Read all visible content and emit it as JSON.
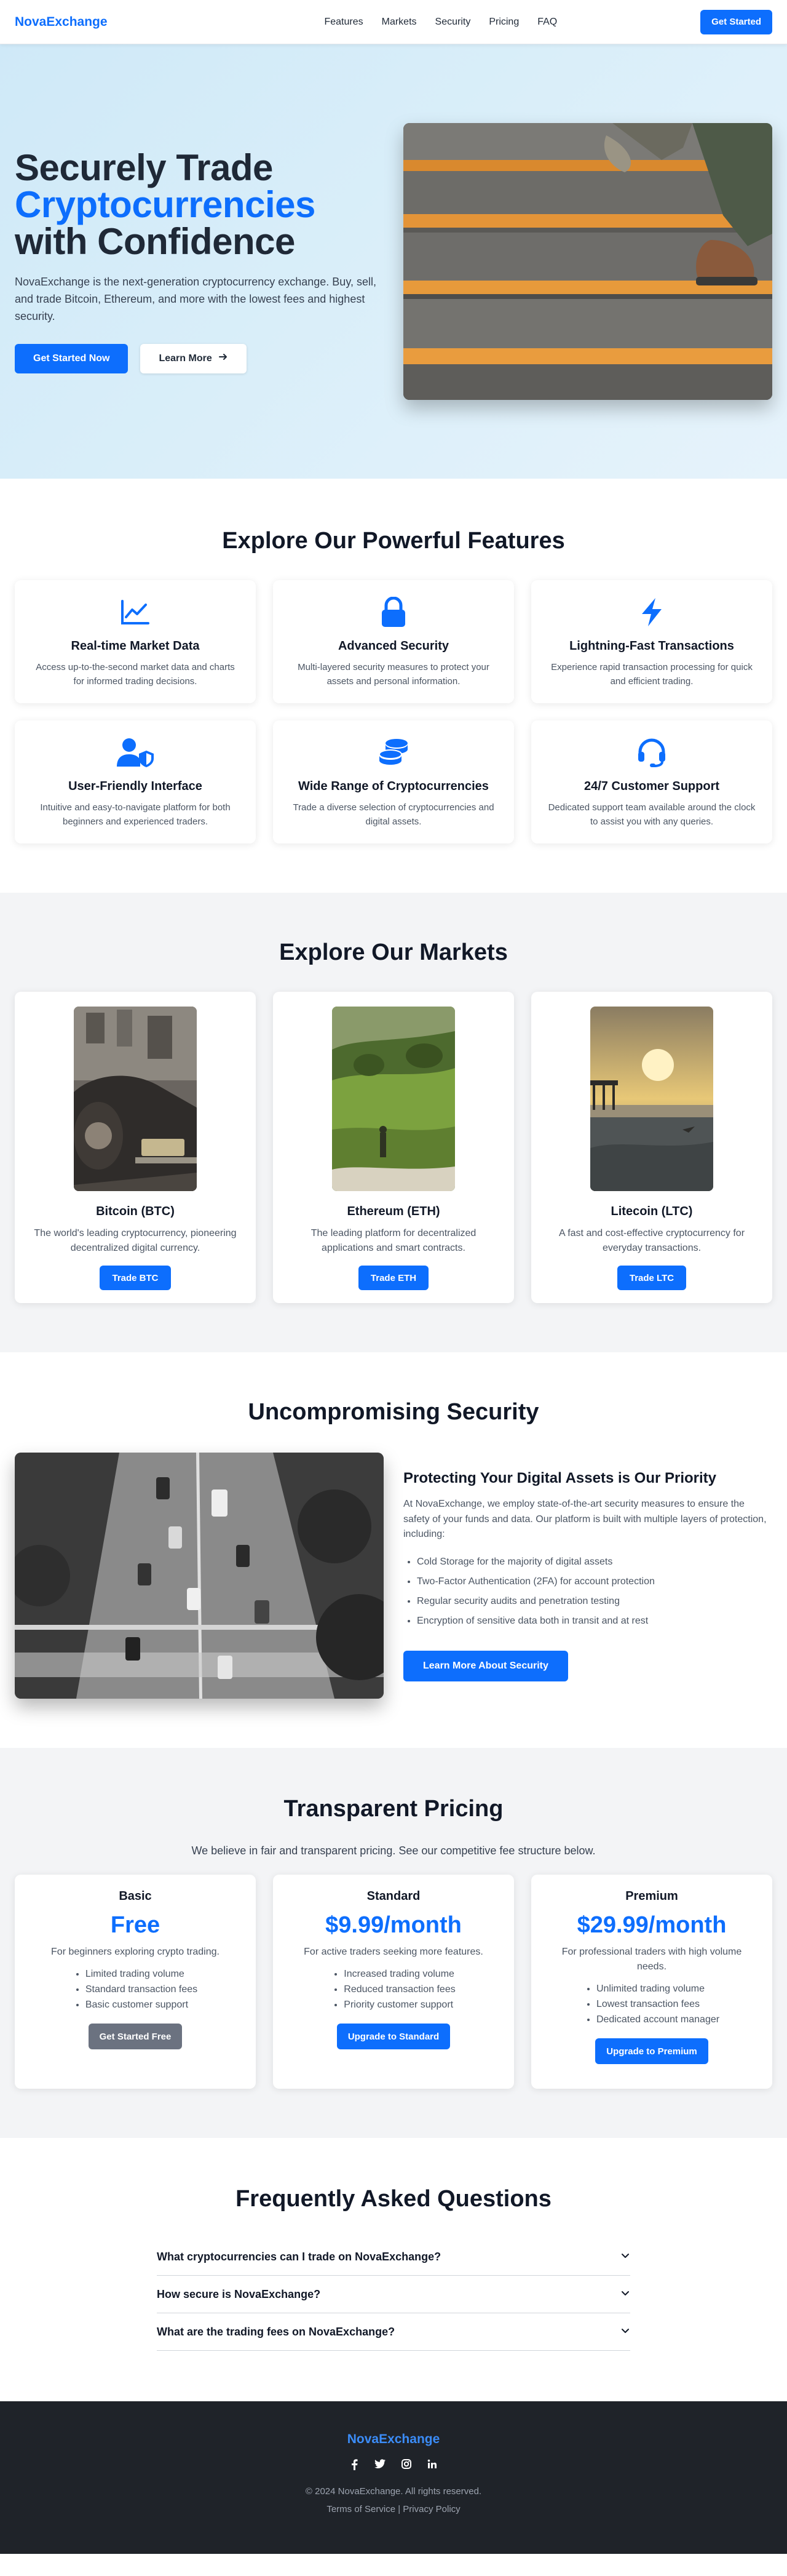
{
  "nav": {
    "logo": "NovaExchange",
    "links": [
      "Features",
      "Markets",
      "Security",
      "Pricing",
      "FAQ"
    ],
    "cta": "Get Started"
  },
  "hero": {
    "title_line1": "Securely Trade",
    "title_accent": "Cryptocurrencies",
    "title_line3": "with Confidence",
    "description": "NovaExchange is the next-generation cryptocurrency exchange. Buy, sell, and trade Bitcoin, Ethereum, and more with the lowest fees and highest security.",
    "primary_button": "Get Started Now",
    "secondary_button": "Learn More",
    "secondary_icon": "arrow-right-icon"
  },
  "features": {
    "title": "Explore Our Powerful Features",
    "items": [
      {
        "icon": "line-chart-icon",
        "title": "Real-time Market Data",
        "description": "Access up-to-the-second market data and charts for informed trading decisions."
      },
      {
        "icon": "lock-icon",
        "title": "Advanced Security",
        "description": "Multi-layered security measures to protect your assets and personal information."
      },
      {
        "icon": "lightning-bolt-icon",
        "title": "Lightning-Fast Transactions",
        "description": "Experience rapid transaction processing for quick and efficient trading."
      },
      {
        "icon": "user-shield-icon",
        "title": "User-Friendly Interface",
        "description": "Intuitive and easy-to-navigate platform for both beginners and experienced traders."
      },
      {
        "icon": "coins-icon",
        "title": "Wide Range of Cryptocurrencies",
        "description": "Trade a diverse selection of cryptocurrencies and digital assets."
      },
      {
        "icon": "headset-icon",
        "title": "24/7 Customer Support",
        "description": "Dedicated support team available around the clock to assist you with any queries."
      }
    ]
  },
  "markets": {
    "title": "Explore Our Markets",
    "items": [
      {
        "name": "Bitcoin (BTC)",
        "description": "The world's leading cryptocurrency, pioneering decentralized digital currency.",
        "button": "Trade BTC"
      },
      {
        "name": "Ethereum (ETH)",
        "description": "The leading platform for decentralized applications and smart contracts.",
        "button": "Trade ETH"
      },
      {
        "name": "Litecoin (LTC)",
        "description": "A fast and cost-effective cryptocurrency for everyday transactions.",
        "button": "Trade LTC"
      }
    ]
  },
  "security": {
    "title": "Uncompromising Security",
    "heading": "Protecting Your Digital Assets is Our Priority",
    "description": "At NovaExchange, we employ state-of-the-art security measures to ensure the safety of your funds and data. Our platform is built with multiple layers of protection, including:",
    "points": [
      "Cold Storage for the majority of digital assets",
      "Two-Factor Authentication (2FA) for account protection",
      "Regular security audits and penetration testing",
      "Encryption of sensitive data both in transit and at rest"
    ],
    "button": "Learn More About Security"
  },
  "pricing": {
    "title": "Transparent Pricing",
    "intro": "We believe in fair and transparent pricing. See our competitive fee structure below.",
    "plans": [
      {
        "name": "Basic",
        "price": "Free",
        "description": "For beginners exploring crypto trading.",
        "features": [
          "Limited trading volume",
          "Standard transaction fees",
          "Basic customer support"
        ],
        "button": "Get Started Free"
      },
      {
        "name": "Standard",
        "price": "$9.99/month",
        "description": "For active traders seeking more features.",
        "features": [
          "Increased trading volume",
          "Reduced transaction fees",
          "Priority customer support"
        ],
        "button": "Upgrade to Standard"
      },
      {
        "name": "Premium",
        "price": "$29.99/month",
        "description": "For professional traders with high volume needs.",
        "features": [
          "Unlimited trading volume",
          "Lowest transaction fees",
          "Dedicated account manager"
        ],
        "button": "Upgrade to Premium"
      }
    ]
  },
  "faq": {
    "title": "Frequently Asked Questions",
    "items": [
      "What cryptocurrencies can I trade on NovaExchange?",
      "How secure is NovaExchange?",
      "What are the trading fees on NovaExchange?"
    ]
  },
  "footer": {
    "logo": "NovaExchange",
    "social": [
      "facebook-icon",
      "twitter-icon",
      "instagram-icon",
      "linkedin-icon"
    ],
    "copyright": "© 2024 NovaExchange. All rights reserved.",
    "terms": "Terms of Service",
    "separator": "|",
    "privacy": "Privacy Policy"
  },
  "colors": {
    "primary": "#0d6efd",
    "footer_bg": "#1f2329",
    "section_gray": "#f3f4f6"
  }
}
